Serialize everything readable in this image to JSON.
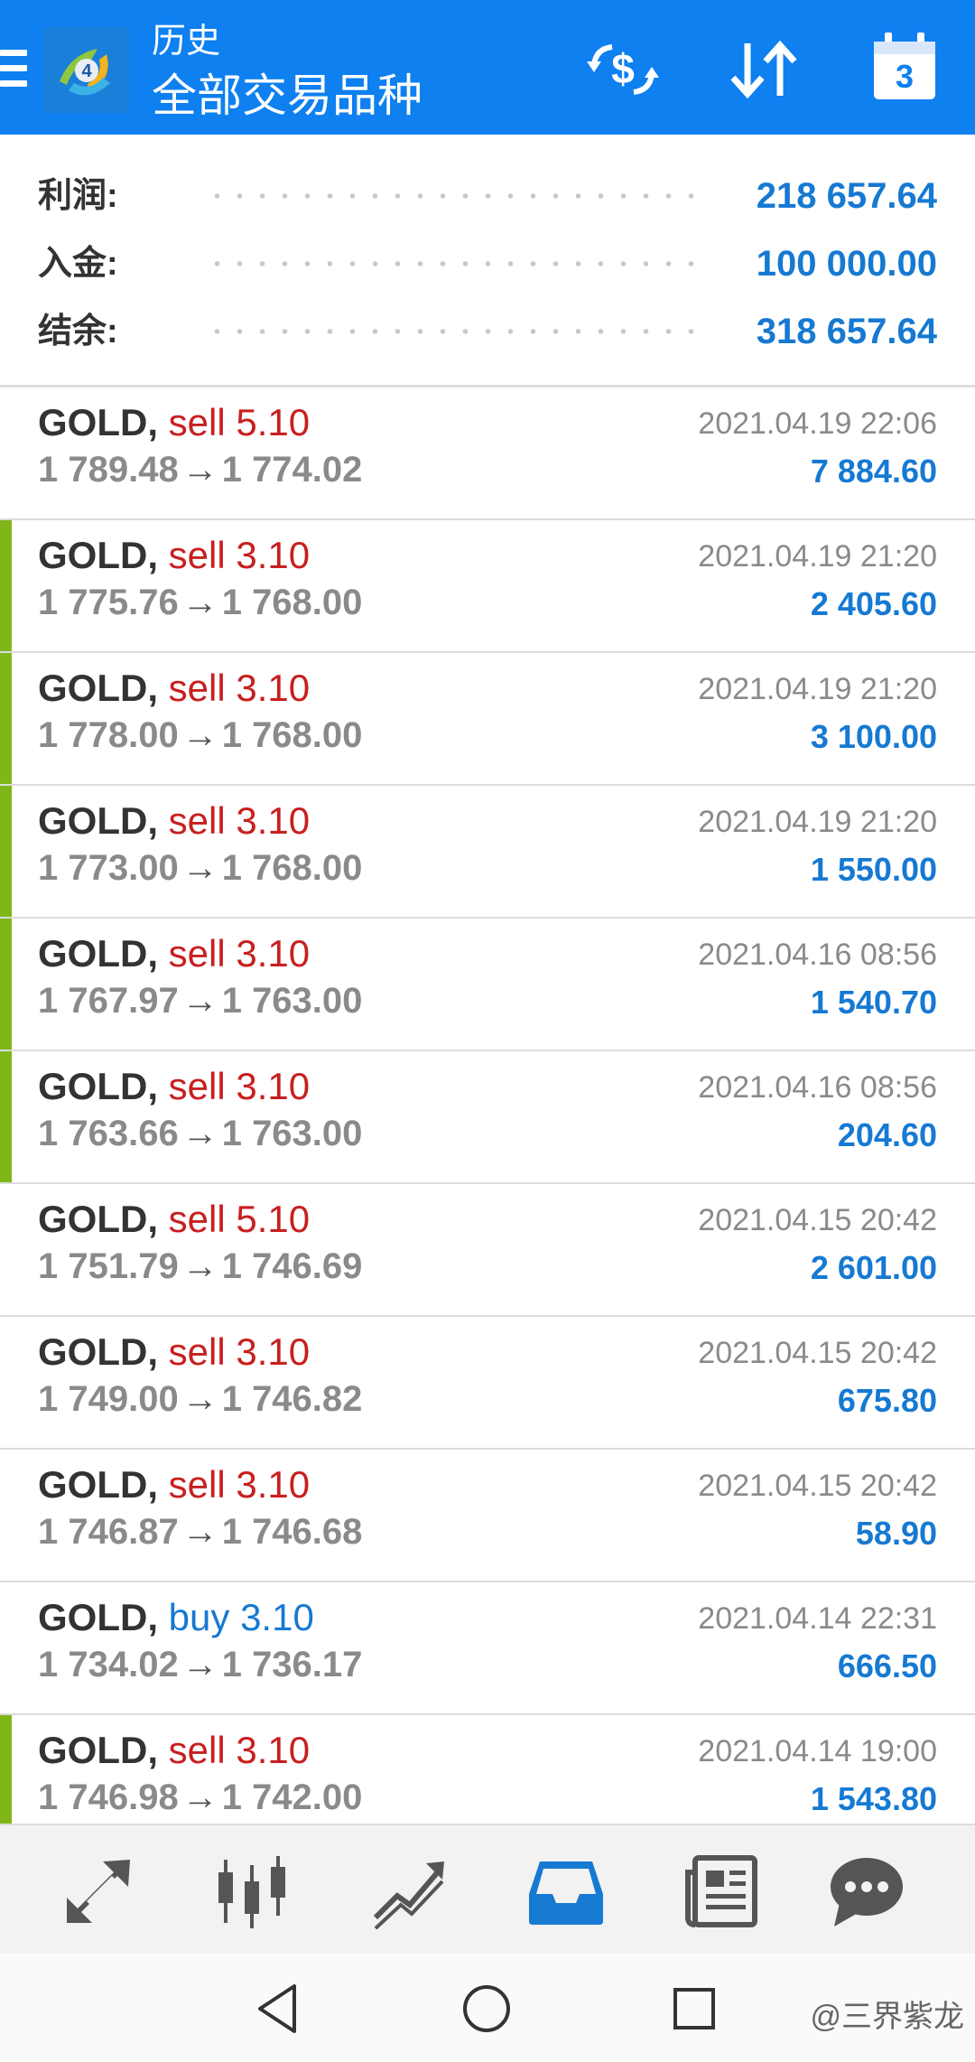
{
  "header": {
    "subtitle": "历史",
    "title": "全部交易品种",
    "calendar_day": "3",
    "icons": {
      "menu": "hamburger-icon",
      "logo": "metatrader-logo",
      "deposit": "dollar-exchange-icon",
      "sort": "sort-arrows-icon",
      "calendar": "calendar-icon"
    }
  },
  "summary": {
    "profit_label": "利润:",
    "profit_value": "218 657.64",
    "deposit_label": "入金:",
    "deposit_value": "100 000.00",
    "balance_label": "结余:",
    "balance_value": "318 657.64"
  },
  "deals": [
    {
      "symbol": "GOLD,",
      "side": "sell",
      "volume": "5.10",
      "open": "1 789.48",
      "close": "1 774.02",
      "time": "2021.04.19 22:06",
      "profit": "7 884.60",
      "marked": false
    },
    {
      "symbol": "GOLD,",
      "side": "sell",
      "volume": "3.10",
      "open": "1 775.76",
      "close": "1 768.00",
      "time": "2021.04.19 21:20",
      "profit": "2 405.60",
      "marked": true
    },
    {
      "symbol": "GOLD,",
      "side": "sell",
      "volume": "3.10",
      "open": "1 778.00",
      "close": "1 768.00",
      "time": "2021.04.19 21:20",
      "profit": "3 100.00",
      "marked": true
    },
    {
      "symbol": "GOLD,",
      "side": "sell",
      "volume": "3.10",
      "open": "1 773.00",
      "close": "1 768.00",
      "time": "2021.04.19 21:20",
      "profit": "1 550.00",
      "marked": true
    },
    {
      "symbol": "GOLD,",
      "side": "sell",
      "volume": "3.10",
      "open": "1 767.97",
      "close": "1 763.00",
      "time": "2021.04.16 08:56",
      "profit": "1 540.70",
      "marked": true
    },
    {
      "symbol": "GOLD,",
      "side": "sell",
      "volume": "3.10",
      "open": "1 763.66",
      "close": "1 763.00",
      "time": "2021.04.16 08:56",
      "profit": "204.60",
      "marked": true
    },
    {
      "symbol": "GOLD,",
      "side": "sell",
      "volume": "5.10",
      "open": "1 751.79",
      "close": "1 746.69",
      "time": "2021.04.15 20:42",
      "profit": "2 601.00",
      "marked": false
    },
    {
      "symbol": "GOLD,",
      "side": "sell",
      "volume": "3.10",
      "open": "1 749.00",
      "close": "1 746.82",
      "time": "2021.04.15 20:42",
      "profit": "675.80",
      "marked": false
    },
    {
      "symbol": "GOLD,",
      "side": "sell",
      "volume": "3.10",
      "open": "1 746.87",
      "close": "1 746.68",
      "time": "2021.04.15 20:42",
      "profit": "58.90",
      "marked": false
    },
    {
      "symbol": "GOLD,",
      "side": "buy",
      "volume": "3.10",
      "open": "1 734.02",
      "close": "1 736.17",
      "time": "2021.04.14 22:31",
      "profit": "666.50",
      "marked": false
    },
    {
      "symbol": "GOLD,",
      "side": "sell",
      "volume": "3.10",
      "open": "1 746.98",
      "close": "1 742.00",
      "time": "2021.04.14 19:00",
      "profit": "1 543.80",
      "marked": true
    }
  ],
  "toolbar": {
    "items": [
      "quotes-arrows-icon",
      "chart-candles-icon",
      "trade-chart-icon",
      "history-inbox-icon",
      "news-icon",
      "messages-chat-icon"
    ],
    "active": "history-inbox-icon",
    "active_color": "#1679d2"
  },
  "system_nav": {
    "watermark": "@三界紫龙",
    "buttons": [
      "back-icon",
      "home-icon",
      "recents-icon"
    ]
  },
  "colors": {
    "appbar": "#0e80f0",
    "value_blue": "#1679d2",
    "sell_red": "#c81f1f",
    "marker_green": "#80b61a"
  }
}
